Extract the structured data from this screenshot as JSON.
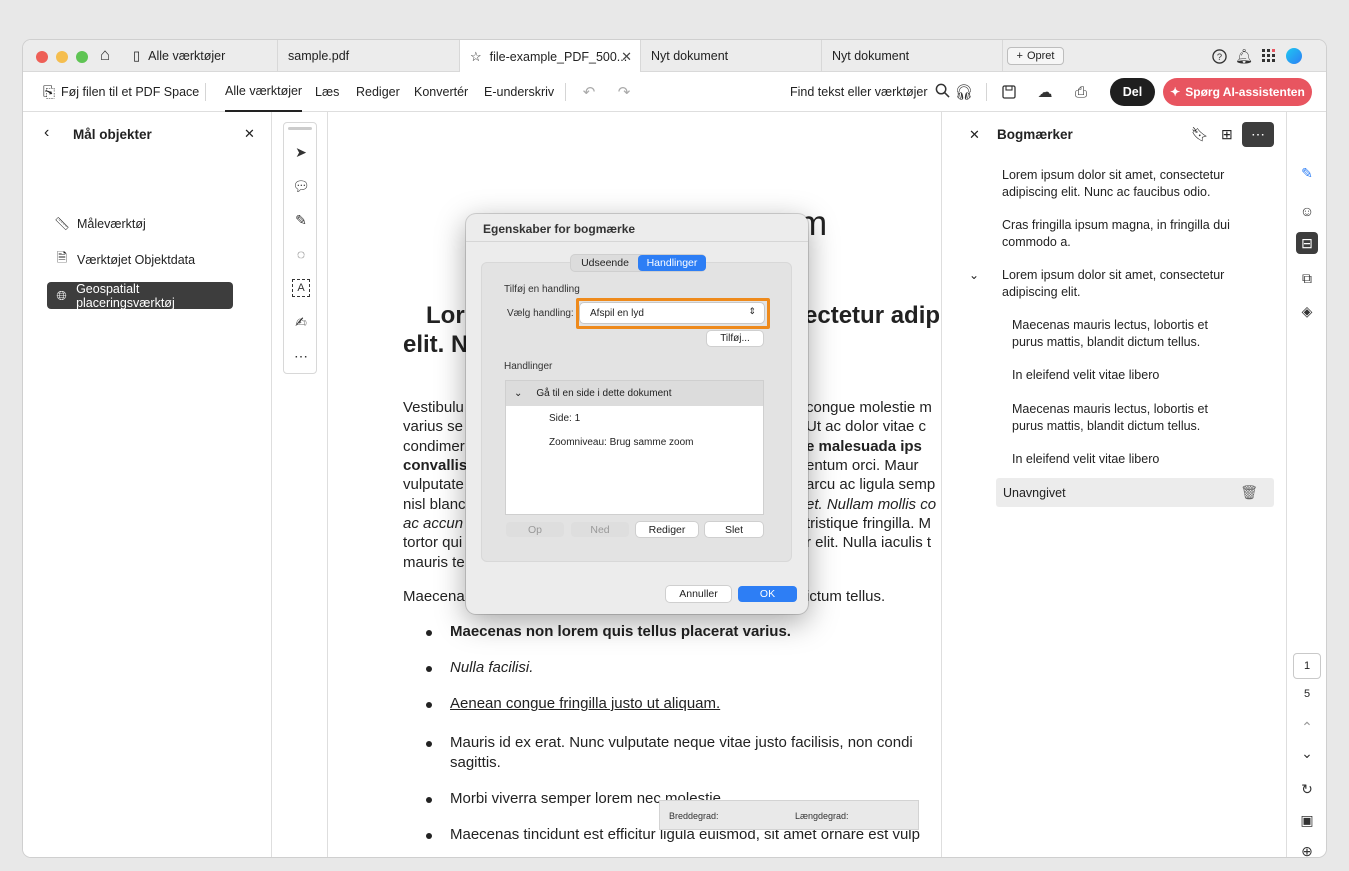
{
  "tabs": [
    {
      "label": "Alle værktøjer",
      "icon": "tools-icon"
    },
    {
      "label": "sample.pdf"
    },
    {
      "label": "file-example_PDF_500...",
      "icon": "star-icon"
    },
    {
      "label": "Nyt dokument"
    },
    {
      "label": "Nyt dokument"
    }
  ],
  "tabbar": {
    "create_label": "Opret"
  },
  "toolbar": {
    "add_to_space": "Føj filen til et PDF Space",
    "menu": [
      "Alle værktøjer",
      "Læs",
      "Rediger",
      "Konvertér",
      "E-underskriv"
    ],
    "find": "Find tekst eller værktøjer",
    "share": "Del",
    "ai": "Spørg AI-assistenten"
  },
  "left_panel": {
    "title": "Mål objekter",
    "items": [
      "Måleværktøj",
      "Værktøjet Objektdata",
      "Geospatialt placeringsværktøj"
    ]
  },
  "document": {
    "heading_fragment": "m",
    "subheading_left_1": "Lor",
    "subheading_left_2": "elit. N",
    "subheading_right": "ectetur adipi",
    "para_left": [
      "Vestibulu",
      "varius se",
      "condimer",
      "convallis",
      "vulputate",
      "nisl blanc",
      "ac accun",
      "tortor qui",
      "mauris te"
    ],
    "para_right": [
      "congue molestie m",
      "Ut ac dolor vitae c",
      "e malesuada ips",
      "entum orci. Maur",
      "arcu ac ligula semp",
      "et. Nullam mollis co",
      "tristique fringilla. M",
      "r elit. Nulla iaculis t",
      ""
    ],
    "maecenas_left": "Maecena",
    "maecenas_right": "ictum tellus.",
    "bullets": [
      "Maecenas non lorem quis tellus placerat varius.",
      "Nulla facilisi.",
      "Aenean congue fringilla justo ut aliquam.",
      "Mauris id ex erat. Nunc vulputate neque vitae justo facilisis, non condi",
      "Morbi viverra semper lorem nec molestie.",
      "Maecenas tincidunt est efficitur ligula euismod, sit amet ornare est vulp"
    ],
    "bullet_4_cont": "sagittis."
  },
  "coords": {
    "lat_label": "Breddegrad:",
    "lon_label": "Længdegrad:"
  },
  "bookmarks": {
    "title": "Bogmærker",
    "items": [
      "Lorem ipsum dolor sit amet, consectetur adipiscing elit. Nunc ac faucibus odio.",
      "Cras fringilla ipsum magna, in fringilla dui commodo a.",
      "Lorem ipsum dolor sit amet, consectetur adipiscing elit."
    ],
    "children": [
      "Maecenas mauris lectus, lobortis et purus mattis, blandit dictum tellus.",
      "In eleifend velit vitae libero",
      "Maecenas mauris lectus, lobortis et purus mattis, blandit dictum tellus.",
      "In eleifend velit vitae libero"
    ],
    "selected": "Unavngivet"
  },
  "rail": {
    "page_current": "1",
    "page_total": "5"
  },
  "dialog": {
    "title": "Egenskaber for bogmærke",
    "segments": [
      "Udseende",
      "Handlinger"
    ],
    "add_action_label": "Tilføj en handling",
    "select_label": "Vælg handling:",
    "select_value": "Afspil en lyd",
    "add_button": "Tilføj...",
    "actions_label": "Handlinger",
    "action_item": "Gå til en side i dette dokument",
    "action_page": "Side: 1",
    "action_zoom": "Zoomniveau: Brug samme zoom",
    "buttons": [
      "Op",
      "Ned",
      "Rediger",
      "Slet"
    ],
    "cancel": "Annuller",
    "ok": "OK"
  },
  "colors": {
    "accent": "#2d7ef5",
    "ai_button": "#e85560",
    "highlight": "#ee8a1c"
  }
}
